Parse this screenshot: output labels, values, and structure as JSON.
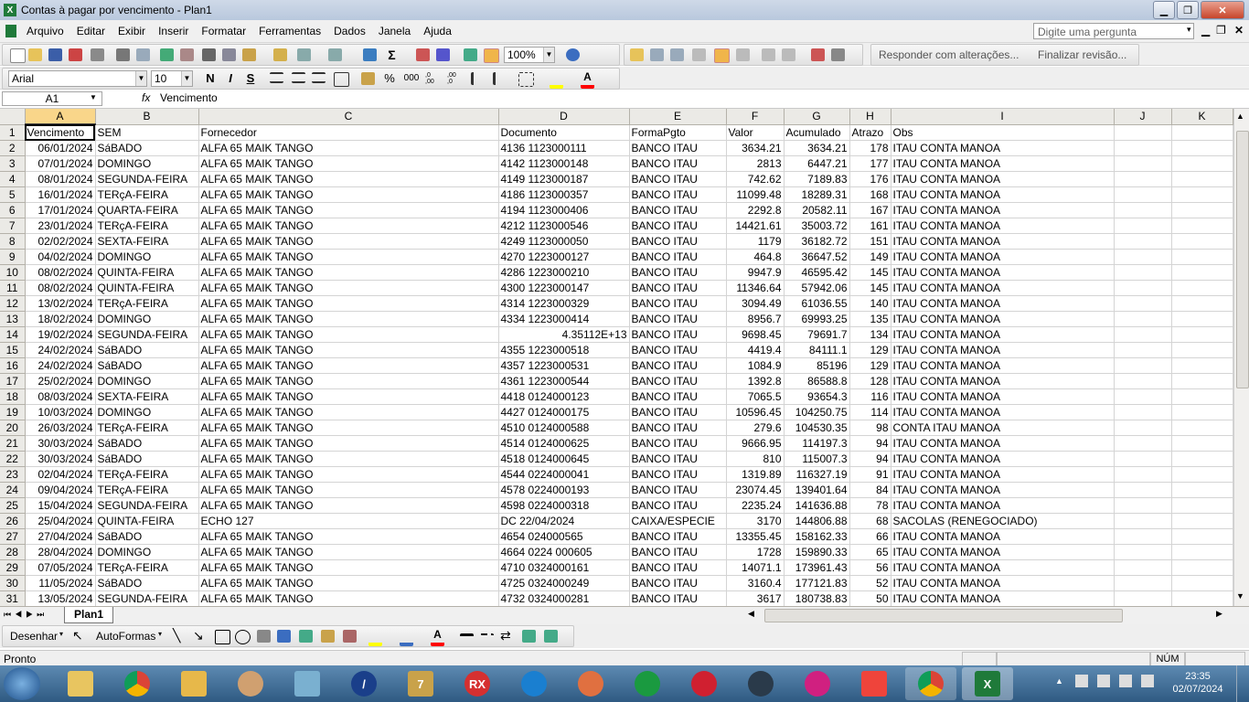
{
  "window": {
    "title": "Contas à pagar por vencimento - Plan1"
  },
  "menu": [
    "Arquivo",
    "Editar",
    "Exibir",
    "Inserir",
    "Formatar",
    "Ferramentas",
    "Dados",
    "Janela",
    "Ajuda"
  ],
  "help_placeholder": "Digite uma pergunta",
  "toolbar": {
    "zoom": "100%",
    "review_reply": "Responder com alterações...",
    "review_finish": "Finalizar revisão..."
  },
  "format": {
    "font": "Arial",
    "size": "10",
    "bold": "N",
    "italic": "I",
    "underline": "S",
    "percent": "%",
    "thousands": "000",
    "dec_inc": ",0\n,00",
    "dec_dec": ",00\n,0"
  },
  "formula_bar": {
    "cell": "A1",
    "fx": "fx",
    "content": "Vencimento"
  },
  "columns": [
    "A",
    "B",
    "C",
    "D",
    "E",
    "F",
    "G",
    "H",
    "I",
    "J",
    "K"
  ],
  "headers": [
    "Vencimento",
    "SEM",
    "Fornecedor",
    "Documento",
    "FormaPgto",
    "Valor",
    "Acumulado",
    "Atrazo",
    "Obs"
  ],
  "rows": [
    [
      "06/01/2024",
      "SáBADO",
      "ALFA 65 MAIK TANGO",
      "4136 1123000111",
      "BANCO ITAU",
      "3634.21",
      "3634.21",
      "178",
      "ITAU CONTA MANOA"
    ],
    [
      "07/01/2024",
      "DOMINGO",
      "ALFA 65 MAIK TANGO",
      "4142 1123000148",
      "BANCO ITAU",
      "2813",
      "6447.21",
      "177",
      "ITAU  CONTA MANOA"
    ],
    [
      "08/01/2024",
      "SEGUNDA-FEIRA",
      "ALFA 65 MAIK TANGO",
      "4149 1123000187",
      "BANCO ITAU",
      "742.62",
      "7189.83",
      "176",
      "ITAU CONTA MANOA"
    ],
    [
      "16/01/2024",
      "TERçA-FEIRA",
      "ALFA 65 MAIK TANGO",
      "4186 1123000357",
      "BANCO ITAU",
      "11099.48",
      "18289.31",
      "168",
      "ITAU CONTA MANOA"
    ],
    [
      "17/01/2024",
      "QUARTA-FEIRA",
      "ALFA 65 MAIK TANGO",
      "4194 1123000406",
      "BANCO ITAU",
      "2292.8",
      "20582.11",
      "167",
      "ITAU CONTA MANOA"
    ],
    [
      "23/01/2024",
      "TERçA-FEIRA",
      "ALFA 65 MAIK TANGO",
      "4212 1123000546",
      "BANCO ITAU",
      "14421.61",
      "35003.72",
      "161",
      "ITAU CONTA MANOA"
    ],
    [
      "02/02/2024",
      "SEXTA-FEIRA",
      "ALFA 65 MAIK TANGO",
      "4249 1123000050",
      "BANCO ITAU",
      "1179",
      "36182.72",
      "151",
      "ITAU CONTA MANOA"
    ],
    [
      "04/02/2024",
      "DOMINGO",
      "ALFA 65 MAIK TANGO",
      "4270 1223000127",
      "BANCO ITAU",
      "464.8",
      "36647.52",
      "149",
      "ITAU CONTA MANOA"
    ],
    [
      "08/02/2024",
      "QUINTA-FEIRA",
      "ALFA 65 MAIK TANGO",
      "4286 1223000210",
      "BANCO ITAU",
      "9947.9",
      "46595.42",
      "145",
      "ITAU CONTA MANOA"
    ],
    [
      "08/02/2024",
      "QUINTA-FEIRA",
      "ALFA 65 MAIK TANGO",
      "4300 1223000147",
      "BANCO ITAU",
      "11346.64",
      "57942.06",
      "145",
      "ITAU CONTA MANOA"
    ],
    [
      "13/02/2024",
      "TERçA-FEIRA",
      "ALFA 65 MAIK TANGO",
      "4314 1223000329",
      "BANCO ITAU",
      "3094.49",
      "61036.55",
      "140",
      "ITAU CONTA MANOA"
    ],
    [
      "18/02/2024",
      "DOMINGO",
      "ALFA 65 MAIK TANGO",
      "4334 1223000414",
      "BANCO ITAU",
      "8956.7",
      "69993.25",
      "135",
      "ITAU CONTA MANOA"
    ],
    [
      "19/02/2024",
      "SEGUNDA-FEIRA",
      "ALFA 65 MAIK TANGO",
      "4.35112E+13",
      "BANCO ITAU",
      "9698.45",
      "79691.7",
      "134",
      "ITAU CONTA MANOA"
    ],
    [
      "24/02/2024",
      "SáBADO",
      "ALFA 65 MAIK TANGO",
      "4355 1223000518",
      "BANCO ITAU",
      "4419.4",
      "84111.1",
      "129",
      "ITAU CONTA MANOA"
    ],
    [
      "24/02/2024",
      "SáBADO",
      "ALFA 65 MAIK TANGO",
      "4357 1223000531",
      "BANCO ITAU",
      "1084.9",
      "85196",
      "129",
      "ITAU CONTA MANOA"
    ],
    [
      "25/02/2024",
      "DOMINGO",
      "ALFA 65 MAIK TANGO",
      "4361 1223000544",
      "BANCO ITAU",
      "1392.8",
      "86588.8",
      "128",
      "ITAU CONTA MANOA"
    ],
    [
      "08/03/2024",
      "SEXTA-FEIRA",
      "ALFA 65 MAIK TANGO",
      "4418 0124000123",
      "BANCO ITAU",
      "7065.5",
      "93654.3",
      "116",
      "ITAU CONTA MANOA"
    ],
    [
      "10/03/2024",
      "DOMINGO",
      "ALFA 65 MAIK TANGO",
      "4427 0124000175",
      "BANCO ITAU",
      "10596.45",
      "104250.75",
      "114",
      "ITAU CONTA MANOA"
    ],
    [
      "26/03/2024",
      "TERçA-FEIRA",
      "ALFA 65 MAIK TANGO",
      "4510 0124000588",
      "BANCO ITAU",
      "279.6",
      "104530.35",
      "98",
      "CONTA ITAU MANOA"
    ],
    [
      "30/03/2024",
      "SáBADO",
      "ALFA 65 MAIK TANGO",
      "4514 0124000625",
      "BANCO ITAU",
      "9666.95",
      "114197.3",
      "94",
      "ITAU CONTA MANOA"
    ],
    [
      "30/03/2024",
      "SáBADO",
      "ALFA 65 MAIK TANGO",
      "4518 0124000645",
      "BANCO ITAU",
      "810",
      "115007.3",
      "94",
      "ITAU CONTA MANOA"
    ],
    [
      "02/04/2024",
      "TERçA-FEIRA",
      "ALFA 65 MAIK TANGO",
      "4544 0224000041",
      "BANCO ITAU",
      "1319.89",
      "116327.19",
      "91",
      "ITAU CONTA MANOA"
    ],
    [
      "09/04/2024",
      "TERçA-FEIRA",
      "ALFA 65 MAIK TANGO",
      "4578 0224000193",
      "BANCO ITAU",
      "23074.45",
      "139401.64",
      "84",
      "ITAU CONTA MANOA"
    ],
    [
      "15/04/2024",
      "SEGUNDA-FEIRA",
      "ALFA 65 MAIK TANGO",
      "4598 0224000318",
      "BANCO ITAU",
      "2235.24",
      "141636.88",
      "78",
      "ITAU CONTA MANOA"
    ],
    [
      "25/04/2024",
      "QUINTA-FEIRA",
      "ECHO 127",
      "DC 22/04/2024",
      "CAIXA/ESPECIE",
      "3170",
      "144806.88",
      "68",
      "SACOLAS (RENEGOCIADO)"
    ],
    [
      "27/04/2024",
      "SáBADO",
      "ALFA 65 MAIK TANGO",
      "4654 024000565",
      "BANCO ITAU",
      "13355.45",
      "158162.33",
      "66",
      "ITAU CONTA MANOA"
    ],
    [
      "28/04/2024",
      "DOMINGO",
      "ALFA 65 MAIK TANGO",
      "4664 0224 000605",
      "BANCO ITAU",
      "1728",
      "159890.33",
      "65",
      "ITAU CONTA MANOA"
    ],
    [
      "07/05/2024",
      "TERçA-FEIRA",
      "ALFA 65 MAIK TANGO",
      "4710 0324000161",
      "BANCO ITAU",
      "14071.1",
      "173961.43",
      "56",
      "ITAU CONTA MANOA"
    ],
    [
      "11/05/2024",
      "SáBADO",
      "ALFA 65 MAIK TANGO",
      "4725 0324000249",
      "BANCO ITAU",
      "3160.4",
      "177121.83",
      "52",
      "ITAU CONTA MANOA"
    ],
    [
      "13/05/2024",
      "SEGUNDA-FEIRA",
      "ALFA 65 MAIK TANGO",
      "4732 0324000281",
      "BANCO ITAU",
      "3617",
      "180738.83",
      "50",
      "ITAU CONTA MANOA"
    ]
  ],
  "right_aligned_doc": "4.35112E+13",
  "sheet_tab": "Plan1",
  "drawing": {
    "draw_label": "Desenhar",
    "autoshapes_label": "AutoFormas"
  },
  "status": {
    "left": "Pronto",
    "num": "NÚM"
  },
  "taskbar": {
    "time": "23:35",
    "date": "02/07/2024"
  }
}
